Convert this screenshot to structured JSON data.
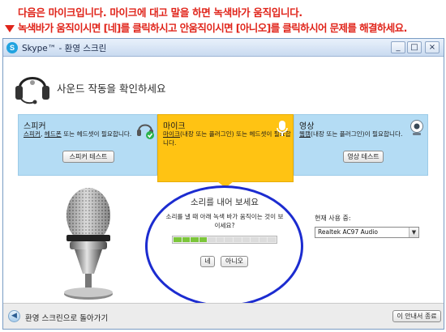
{
  "banner": {
    "line1": "다음은 마이크입니다. 마이크에 대고 말을 하면 녹색바가 움직입니다.",
    "line2": "녹색바가 움직이시면 [네]를 클릭하시고 안움직이시면 [아니오]를 클릭하시어 문제를 해결하세요."
  },
  "window": {
    "title": "Skype™ - 환영 스크린",
    "minimize": "_",
    "maximize": "□",
    "close": "×"
  },
  "header": {
    "title": "사운드 작동을 확인하세요"
  },
  "cards": {
    "speaker": {
      "title": "스피커",
      "link1": "스피커",
      "sep1": ", ",
      "link2": "헤드폰",
      "desc_rest": " 또는 헤드셋이 필요합니다.",
      "button": "스피커 테스트"
    },
    "mic": {
      "title": "마이크",
      "link1": "마이크",
      "desc_rest": "(내장 또는 플러그인) 또는 헤드셋이 필요합니다."
    },
    "video": {
      "title": "영상",
      "link1": "웹캠",
      "desc_rest": "(내장 또는 플러그인)이 필요합니다.",
      "button": "영상 테스트"
    }
  },
  "prompt": {
    "title": "소리를 내어 보세요",
    "desc": "소리를 낼 때 아래 녹색 바가 움직이는 것이 보이세요?",
    "meter_level": 0.33,
    "yes": "네",
    "no": "아니오"
  },
  "device": {
    "label": "현재 사용 중:",
    "selected": "Realtek AC97 Audio"
  },
  "footer": {
    "back": "환영 스크린으로 돌아가기",
    "exit": "이 안내서 종료"
  },
  "colors": {
    "banner_text": "#e0241a",
    "mic_card": "#ffc313",
    "side_card": "#b4dcf4",
    "meter_on": "#7cc63a",
    "oval": "#1c2cd0"
  }
}
